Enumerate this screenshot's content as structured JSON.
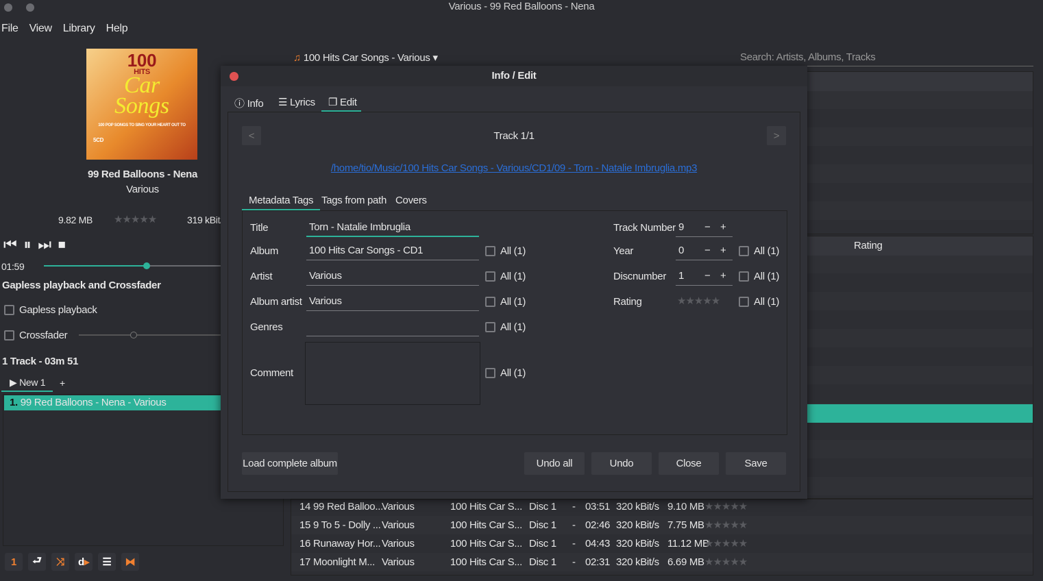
{
  "window": {
    "title": "Various - 99 Red Balloons - Nena"
  },
  "menu": [
    "File",
    "View",
    "Library",
    "Help"
  ],
  "now_playing": {
    "title": "99 Red Balloons - Nena",
    "artist": "Various",
    "size": "9.82 MB",
    "bitrate": "319 kBit/s",
    "rating": 0,
    "time": "01:59",
    "progress": 0.58,
    "cover_text": [
      "100",
      "HITS",
      "Car",
      "Songs",
      "100 POP SONGS TO SING YOUR HEART OUT TO",
      "5CD"
    ]
  },
  "playback": {
    "section_title": "Gapless playback and Crossfader",
    "gapless_label": "Gapless playback",
    "gapless": false,
    "crossfader_label": "Crossfader",
    "crossfader": false,
    "crossfader_value": 0.5
  },
  "playlist": {
    "summary": "1 Track - 03m 51",
    "tab": "New 1",
    "add_tab": "+",
    "items": [
      {
        "num": "1.",
        "text": "99 Red Balloons - Nena - Various"
      }
    ]
  },
  "library": {
    "album_selector": "100 Hits Car Songs - Various",
    "search_placeholder": "Search: Artists, Albums, Tracks",
    "rating_header": "Rating",
    "tracks": [
      {
        "num": "14",
        "title": "99 Red Balloo...",
        "artist": "Various",
        "album": "100 Hits Car S...",
        "disc": "Disc 1",
        "year": "-",
        "length": "03:51",
        "bitrate": "320 kBit/s",
        "size": "9.10 MB",
        "rating": 0
      },
      {
        "num": "15",
        "title": "9 To 5 - Dolly ...",
        "artist": "Various",
        "album": "100 Hits Car S...",
        "disc": "Disc 1",
        "year": "-",
        "length": "02:46",
        "bitrate": "320 kBit/s",
        "size": "7.75 MB",
        "rating": 0
      },
      {
        "num": "16",
        "title": "Runaway Hor...",
        "artist": "Various",
        "album": "100 Hits Car S...",
        "disc": "Disc 1",
        "year": "-",
        "length": "04:43",
        "bitrate": "320 kBit/s",
        "size": "11.12 MB",
        "rating": 0
      },
      {
        "num": "17",
        "title": "Moonlight M...",
        "artist": "Various",
        "album": "100 Hits Car S...",
        "disc": "Disc 1",
        "year": "-",
        "length": "02:31",
        "bitrate": "320 kBit/s",
        "size": "6.69 MB",
        "rating": 0
      }
    ]
  },
  "dialog": {
    "title": "Info / Edit",
    "tabs": [
      "Info",
      "Lyrics",
      "Edit"
    ],
    "active_tab": "Edit",
    "track_label": "Track 1/1",
    "prev": "<",
    "next": ">",
    "filepath": "/home/tio/Music/100 Hits Car Songs - Various/CD1/09 - Torn - Natalie Imbruglia.mp3",
    "subtabs": [
      "Metadata Tags",
      "Tags from path",
      "Covers"
    ],
    "active_subtab": "Metadata Tags",
    "fields": {
      "title_label": "Title",
      "title": "Torn - Natalie Imbruglia",
      "album_label": "Album",
      "album": "100 Hits Car Songs - CD1",
      "artist_label": "Artist",
      "artist": "Various",
      "album_artist_label": "Album artist",
      "album_artist": "Various",
      "genres_label": "Genres",
      "genres": "",
      "comment_label": "Comment",
      "comment": "",
      "track_label": "Track Number",
      "track": "9",
      "year_label": "Year",
      "year": "0",
      "disc_label": "Discnumber",
      "disc": "1",
      "rating_label": "Rating",
      "rating": 0
    },
    "all_label": "All (1)",
    "minus": "−",
    "plus": "+",
    "buttons": {
      "load_album": "Load complete album",
      "undo_all": "Undo all",
      "undo": "Undo",
      "close": "Close",
      "save": "Save"
    }
  },
  "colors": {
    "accent": "#2db39a",
    "link": "#2a6ed8",
    "close": "#e05252",
    "toolbar_icon": "#f08030"
  }
}
